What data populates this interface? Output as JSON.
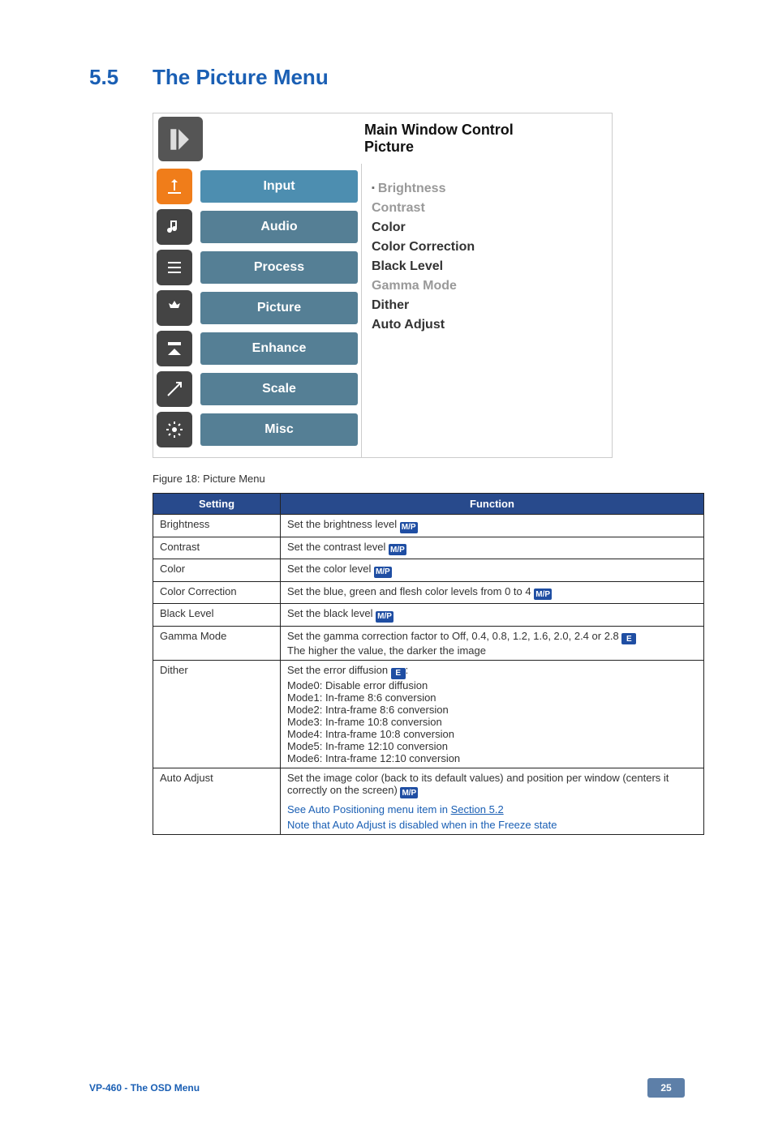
{
  "heading": {
    "num": "5.5",
    "text": "The Picture Menu"
  },
  "osd": {
    "title_main": "Main Window Control",
    "title_sub": "Picture",
    "tabs": [
      "Input",
      "Audio",
      "Process",
      "Picture",
      "Enhance",
      "Scale",
      "Misc"
    ],
    "right_items": [
      {
        "label": "Brightness",
        "selected": true,
        "dark": false
      },
      {
        "label": "Contrast",
        "selected": false,
        "dark": false
      },
      {
        "label": "Color",
        "selected": false,
        "dark": true
      },
      {
        "label": "Color Correction",
        "selected": false,
        "dark": true
      },
      {
        "label": "Black Level",
        "selected": false,
        "dark": true
      },
      {
        "label": "Gamma Mode",
        "selected": false,
        "dark": false
      },
      {
        "label": "Dither",
        "selected": false,
        "dark": true
      },
      {
        "label": "Auto Adjust",
        "selected": false,
        "dark": true
      }
    ]
  },
  "figure_caption": "Figure 18: Picture Menu",
  "table": {
    "head_setting": "Setting",
    "head_function": "Function",
    "rows": {
      "brightness": {
        "s": "Brightness",
        "f": "Set the brightness level "
      },
      "contrast": {
        "s": "Contrast",
        "f": "Set the contrast level "
      },
      "color": {
        "s": "Color",
        "f": "Set the color level "
      },
      "colorcorr": {
        "s": "Color Correction",
        "f": "Set the blue, green and flesh color levels from 0 to 4 "
      },
      "blacklevel": {
        "s": "Black Level",
        "f": "Set the black level "
      },
      "gamma": {
        "s": "Gamma Mode",
        "f1": "Set the gamma correction factor to Off, 0.4, 0.8, 1.2, 1.6, 2.0, 2.4 or 2.8 ",
        "f2": "The higher the value, the darker the image"
      },
      "dither": {
        "s": "Dither",
        "l0": "Set the error diffusion ",
        "l1": "Mode0: Disable error diffusion",
        "l2": "Mode1: In-frame 8:6 conversion",
        "l3": "Mode2: Intra-frame 8:6 conversion",
        "l4": "Mode3: In-frame 10:8 conversion",
        "l5": "Mode4: Intra-frame 10:8 conversion",
        "l6": "Mode5: In-frame 12:10 conversion",
        "l7": "Mode6: Intra-frame 12:10 conversion"
      },
      "autoadjust": {
        "s": "Auto Adjust",
        "f1a": "Set the image color (back to its default values) and position per window (centers it correctly on the screen) ",
        "note1_pre": "See Auto Positioning menu item in ",
        "note1_link": "Section 5.2",
        "note2": "Note that Auto Adjust is disabled when in the Freeze state"
      }
    }
  },
  "badges": {
    "mp": "M/P",
    "e": "E"
  },
  "footer": {
    "model": "VP-460",
    "section": " - The OSD Menu",
    "page": "25"
  }
}
